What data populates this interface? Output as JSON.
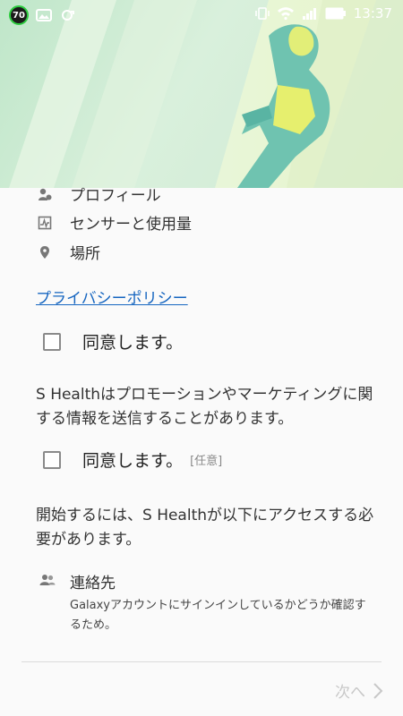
{
  "status_bar": {
    "notification_count": "70",
    "time": "13:37"
  },
  "permissions": [
    {
      "label": "プロフィール",
      "icon": "profile-icon"
    },
    {
      "label": "センサーと使用量",
      "icon": "sensor-icon"
    },
    {
      "label": "場所",
      "icon": "location-icon"
    }
  ],
  "privacy_policy_link": "プライバシーポリシー",
  "agree_required": {
    "label": "同意します。"
  },
  "marketing_text": "S Healthはプロモーションやマーケティングに関する情報を送信することがあります。",
  "agree_optional": {
    "label": "同意します。",
    "optional_tag": "[任意]"
  },
  "access_text": "開始するには、S Healthが以下にアクセスする必要があります。",
  "contacts": {
    "label": "連絡先",
    "description": "Galaxyアカウントにサインインしているかどうか確認するため。"
  },
  "footer": {
    "next_label": "次へ"
  },
  "colors": {
    "link": "#1565c0",
    "banner": "#cde8d2",
    "accent": "#e6f27a"
  }
}
